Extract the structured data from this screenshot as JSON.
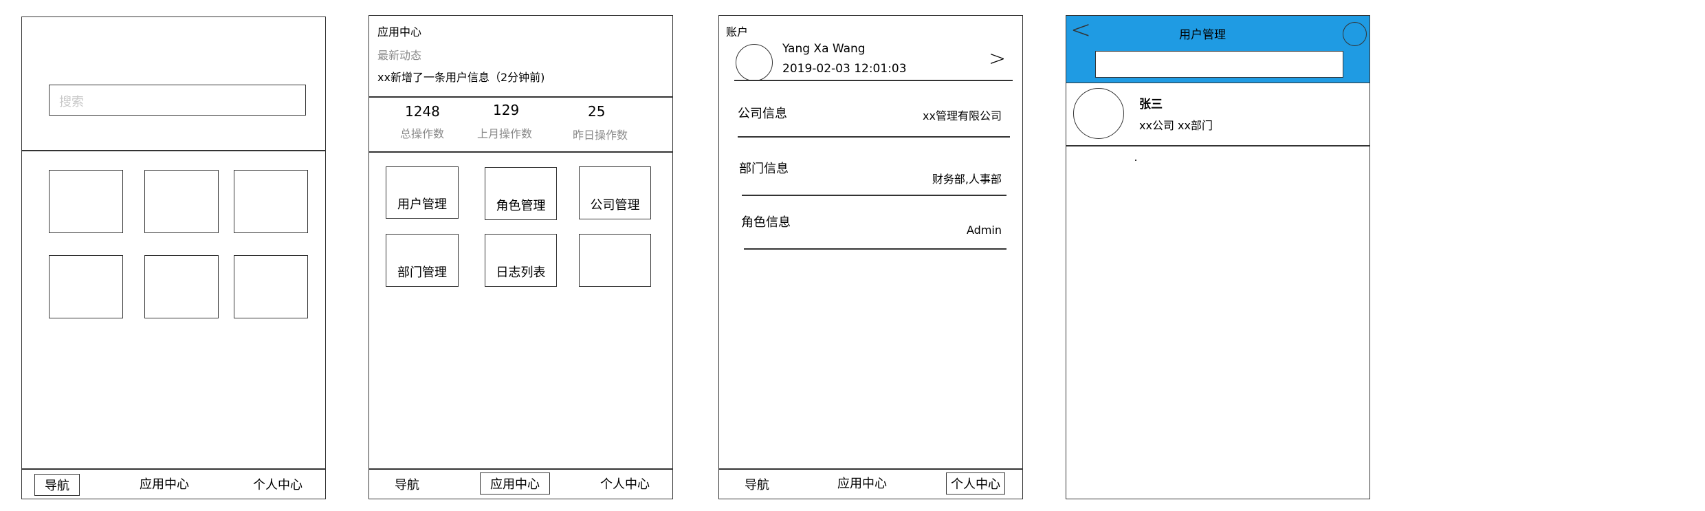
{
  "screen1": {
    "search_placeholder": "搜索",
    "nav": [
      "导航",
      "应用中心",
      "个人中心"
    ]
  },
  "screen2": {
    "title": "应用中心",
    "news_label": "最新动态",
    "news_item": "xx新增了一条用户信息（2分钟前)",
    "stats": [
      {
        "value": "1248",
        "label": "总操作数"
      },
      {
        "value": "129",
        "label": "上月操作数"
      },
      {
        "value": "25",
        "label": "昨日操作数"
      }
    ],
    "tiles": [
      "用户管理",
      "角色管理",
      "公司管理",
      "部门管理",
      "日志列表",
      ""
    ],
    "nav": [
      "导航",
      "应用中心",
      "个人中心"
    ]
  },
  "screen3": {
    "title": "账户",
    "user_name": "Yang Xa Wang",
    "user_time": "2019-02-03 12:01:03",
    "arrow": ">",
    "rows": [
      {
        "label": "公司信息",
        "value": "xx管理有限公司"
      },
      {
        "label": "部门信息",
        "value": "财务部,人事部"
      },
      {
        "label": "角色信息",
        "value": "Admin"
      }
    ],
    "nav": [
      "导航",
      "应用中心",
      "个人中心"
    ]
  },
  "screen4": {
    "title": "用户管理",
    "back": "<",
    "header_color": "#1f9be3",
    "user_name": "张三",
    "user_info": "xx公司 xx部门"
  }
}
